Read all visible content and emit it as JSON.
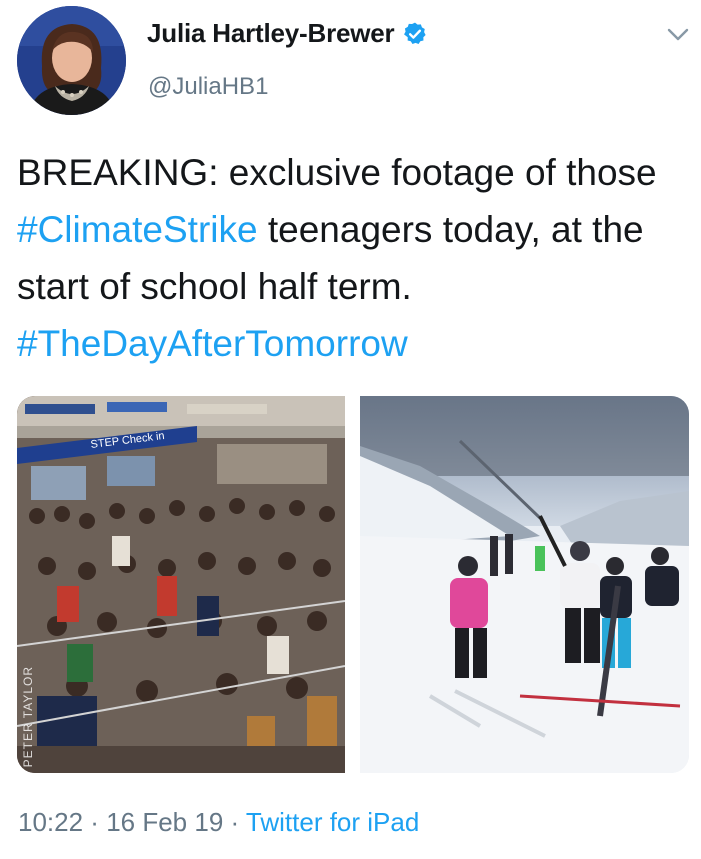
{
  "author": {
    "display_name": "Julia Hartley-Brewer",
    "handle": "@JuliaHB1",
    "verified": true,
    "avatar": "avatar-photo"
  },
  "tweet": {
    "text_before_hashtag1": "BREAKING: exclusive footage of those ",
    "hashtag1": "#ClimateStrike",
    "text_between": " teenagers today, at the start of school half term. ",
    "hashtag2": "#TheDayAfterTomorrow"
  },
  "media": {
    "photo1": {
      "description": "airport-queue-photo",
      "watermark": "PETER TAYLOR"
    },
    "photo2": {
      "description": "ski-slope-photo"
    }
  },
  "meta": {
    "time": "10:22",
    "separator": " · ",
    "date": "16 Feb 19",
    "source": "Twitter for iPad"
  },
  "colors": {
    "link": "#1da1f2",
    "secondary_text": "#657786",
    "primary_text": "#14171a",
    "verified_badge": "#1da1f2"
  },
  "icons": [
    "verified-badge-icon",
    "chevron-down-icon"
  ]
}
